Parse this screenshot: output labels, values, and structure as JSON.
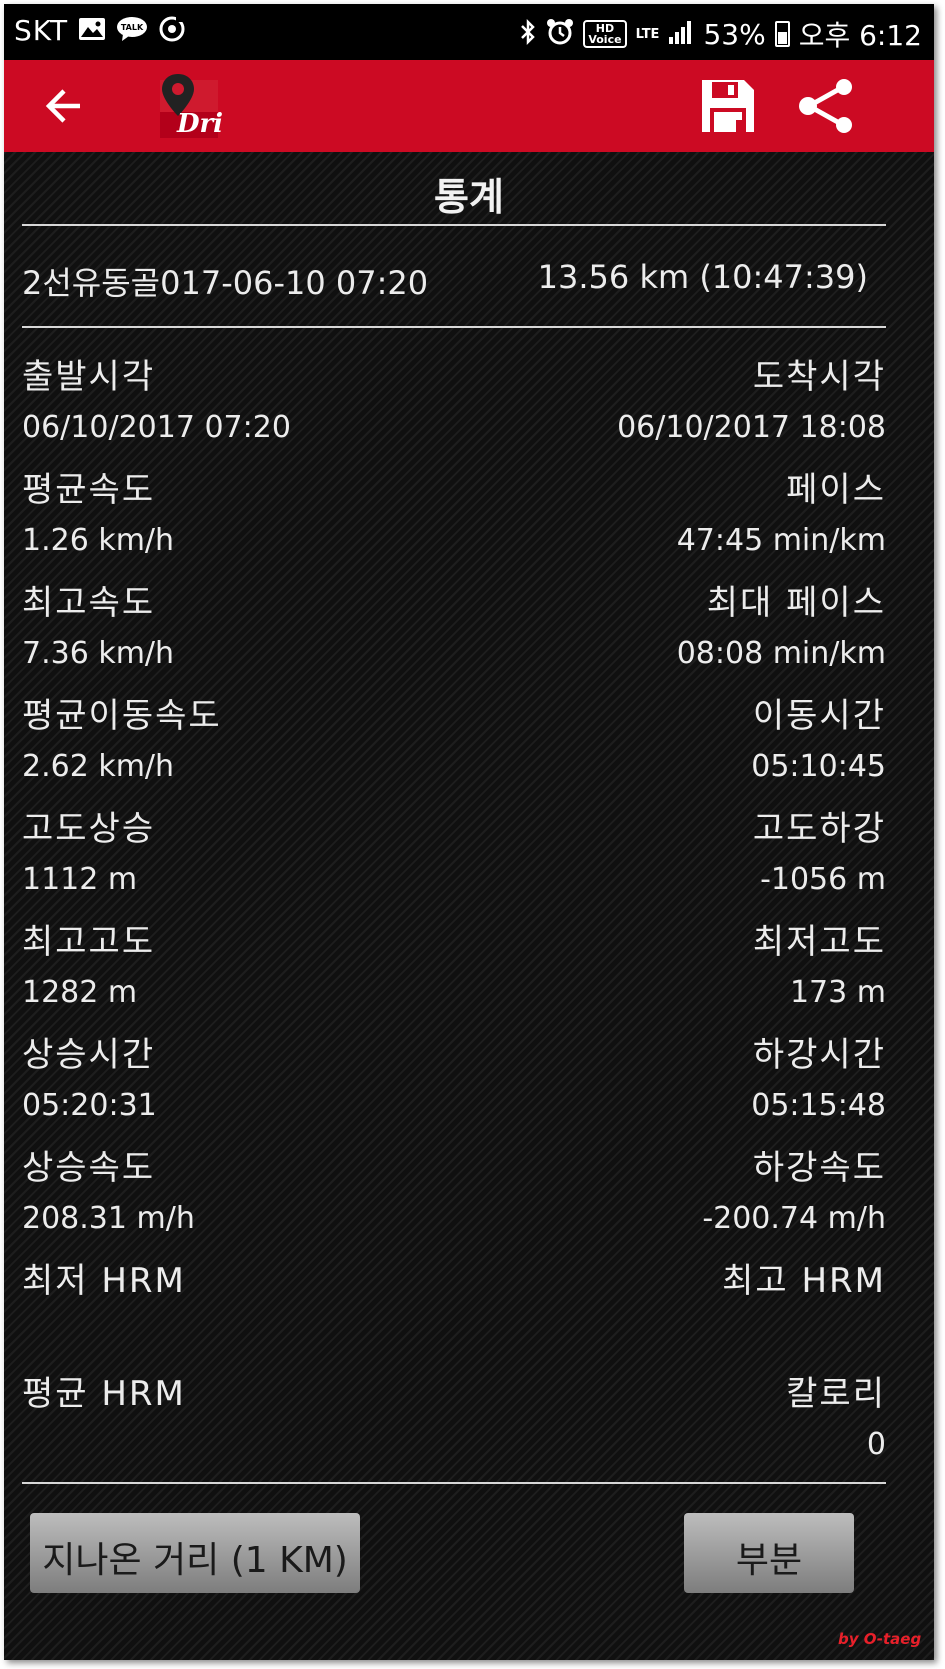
{
  "status_bar": {
    "carrier": "SKT",
    "battery": "53%",
    "time": "오후 6:12",
    "hd_top": "HD",
    "hd_bottom": "Voice",
    "network": "LTE",
    "battery_level": 0.53
  },
  "app_bar": {
    "logo_text": "Dri",
    "icons": [
      "back-arrow-icon",
      "app-logo-icon",
      "save-icon",
      "share-icon"
    ],
    "color": "#cc0a23"
  },
  "page": {
    "title": "통계",
    "trip_name": "2선유동골017-06-10 07:20",
    "trip_summary": "13.56 km (10:47:39)"
  },
  "stats": [
    {
      "left_label": "출발시각",
      "left_value": "06/10/2017 07:20",
      "right_label": "도착시각",
      "right_value": "06/10/2017 18:08"
    },
    {
      "left_label": "평균속도",
      "left_value": "1.26 km/h",
      "right_label": "페이스",
      "right_value": "47:45 min/km"
    },
    {
      "left_label": "최고속도",
      "left_value": "7.36 km/h",
      "right_label": "최대 페이스",
      "right_value": "08:08 min/km"
    },
    {
      "left_label": "평균이동속도",
      "left_value": "2.62 km/h",
      "right_label": "이동시간",
      "right_value": "05:10:45"
    },
    {
      "left_label": "고도상승",
      "left_value": "1112 m",
      "right_label": "고도하강",
      "right_value": "-1056 m"
    },
    {
      "left_label": "최고고도",
      "left_value": "1282 m",
      "right_label": "최저고도",
      "right_value": "173 m"
    },
    {
      "left_label": "상승시간",
      "left_value": "05:20:31",
      "right_label": "하강시간",
      "right_value": "05:15:48"
    },
    {
      "left_label": "상승속도",
      "left_value": "208.31 m/h",
      "right_label": "하강속도",
      "right_value": "-200.74 m/h"
    },
    {
      "left_label": "최저 HRM",
      "left_value": "",
      "right_label": "최고 HRM",
      "right_value": ""
    },
    {
      "left_label": "평균 HRM",
      "left_value": "",
      "right_label": "칼로리",
      "right_value": "0"
    }
  ],
  "buttons": {
    "distance": "지나온 거리 (1 KM)",
    "section": "부분"
  },
  "watermark": "by O-taeg"
}
